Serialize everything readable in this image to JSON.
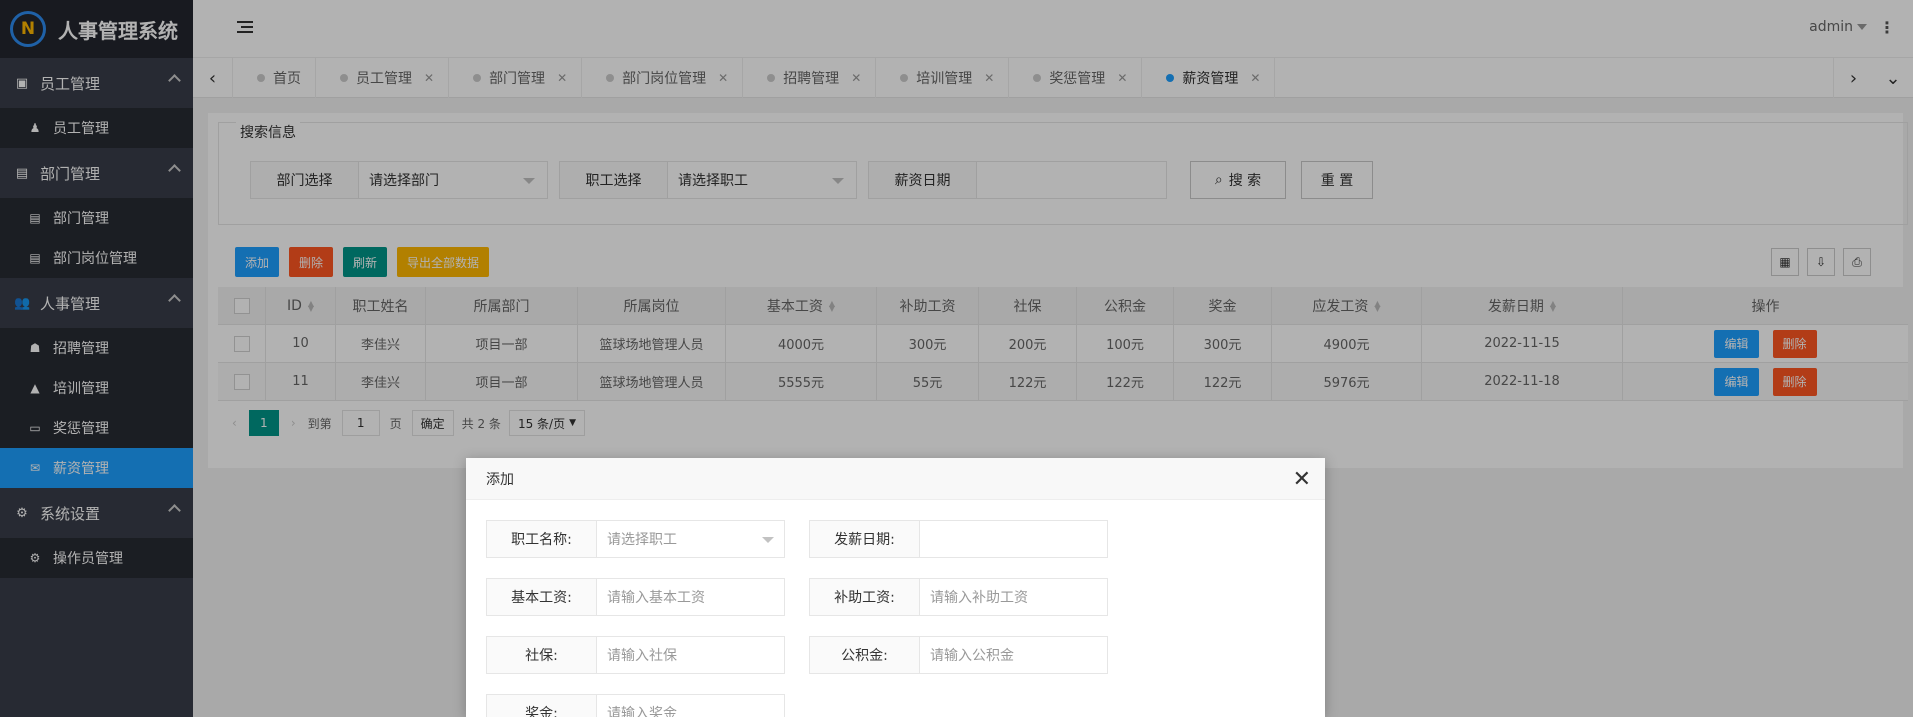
{
  "app": {
    "title": "人事管理系统",
    "logo_text": "N"
  },
  "sidebar": {
    "groups": [
      {
        "label": "员工管理",
        "icon": "id-card-icon",
        "items": [
          {
            "label": "员工管理",
            "icon": "person-icon"
          }
        ]
      },
      {
        "label": "部门管理",
        "icon": "address-card-icon",
        "items": [
          {
            "label": "部门管理",
            "icon": "address-card-icon"
          },
          {
            "label": "部门岗位管理",
            "icon": "address-card-icon"
          }
        ]
      },
      {
        "label": "人事管理",
        "icon": "users-icon",
        "items": [
          {
            "label": "招聘管理",
            "icon": "user-plus-icon"
          },
          {
            "label": "培训管理",
            "icon": "graduation-cap-icon"
          },
          {
            "label": "奖惩管理",
            "icon": "monitor-icon"
          },
          {
            "label": "薪资管理",
            "icon": "envelope-icon",
            "active": true
          }
        ]
      },
      {
        "label": "系统设置",
        "icon": "cogs-icon",
        "items": [
          {
            "label": "操作员管理",
            "icon": "cogs-icon"
          }
        ]
      }
    ]
  },
  "header": {
    "user": "admin"
  },
  "tabs": [
    {
      "label": "首页",
      "closable": false
    },
    {
      "label": "员工管理",
      "closable": true
    },
    {
      "label": "部门管理",
      "closable": true
    },
    {
      "label": "部门岗位管理",
      "closable": true
    },
    {
      "label": "招聘管理",
      "closable": true
    },
    {
      "label": "培训管理",
      "closable": true
    },
    {
      "label": "奖惩管理",
      "closable": true
    },
    {
      "label": "薪资管理",
      "closable": true,
      "active": true
    }
  ],
  "search": {
    "legend": "搜索信息",
    "dept_label": "部门选择",
    "dept_value": "请选择部门",
    "emp_label": "职工选择",
    "emp_value": "请选择职工",
    "date_label": "薪资日期",
    "date_value": "",
    "search_button": "搜 索",
    "reset_button": "重 置"
  },
  "toolbar": {
    "add": "添加",
    "delete": "删除",
    "refresh": "刷新",
    "export": "导出全部数据"
  },
  "table": {
    "columns": [
      "ID",
      "职工姓名",
      "所属部门",
      "所属岗位",
      "基本工资",
      "补助工资",
      "社保",
      "公积金",
      "奖金",
      "应发工资",
      "发薪日期",
      "操作"
    ],
    "rows": [
      {
        "id": "10",
        "name": "李佳兴",
        "dept": "项目一部",
        "post": "篮球场地管理人员",
        "base": "4000元",
        "subsidy": "300元",
        "social": "200元",
        "fund": "100元",
        "bonus": "300元",
        "total": "4900元",
        "date": "2022-11-15"
      },
      {
        "id": "11",
        "name": "李佳兴",
        "dept": "项目一部",
        "post": "篮球场地管理人员",
        "base": "5555元",
        "subsidy": "55元",
        "social": "122元",
        "fund": "122元",
        "bonus": "122元",
        "total": "5976元",
        "date": "2022-11-18"
      }
    ],
    "edit": "编辑",
    "remove": "删除"
  },
  "pager": {
    "current": "1",
    "goto": "到第",
    "page_input": "1",
    "page_unit": "页",
    "confirm": "确定",
    "total": "共 2 条",
    "per_page": "15 条/页"
  },
  "modal": {
    "title": "添加",
    "fields": {
      "emp_label": "职工名称:",
      "emp_placeholder": "请选择职工",
      "date_label": "发薪日期:",
      "date_placeholder": "",
      "base_label": "基本工资:",
      "base_placeholder": "请输入基本工资",
      "subsidy_label": "补助工资:",
      "subsidy_placeholder": "请输入补助工资",
      "social_label": "社保:",
      "social_placeholder": "请输入社保",
      "fund_label": "公积金:",
      "fund_placeholder": "请输入公积金",
      "bonus_label": "奖金:",
      "bonus_placeholder": "请输入奖金"
    }
  },
  "colors": {
    "primary": "#1e9fff",
    "danger": "#ff5722",
    "teal": "#009688",
    "warm": "#ffb800",
    "sidebar": "#393d49"
  }
}
